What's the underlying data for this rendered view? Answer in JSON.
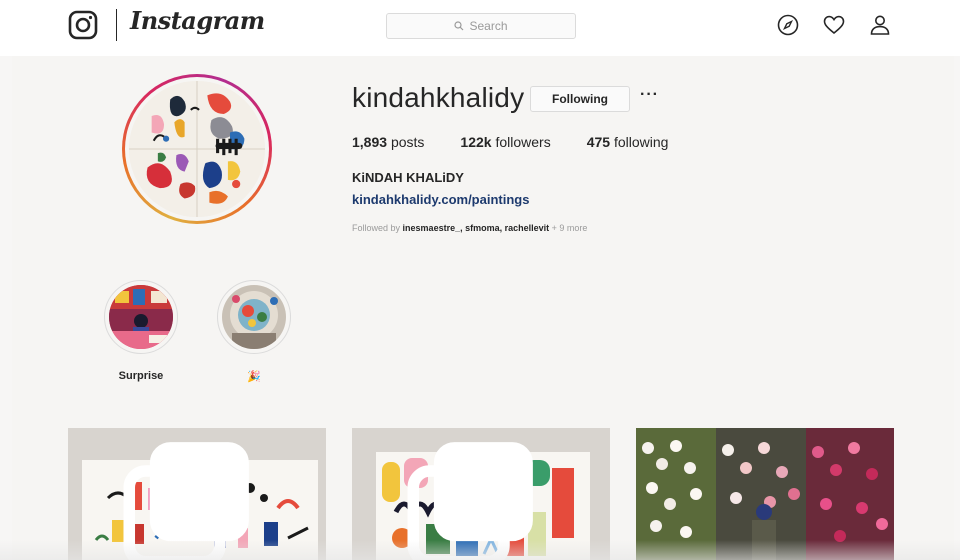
{
  "nav": {
    "wordmark": "Instagram",
    "search_placeholder": "Search",
    "icons": [
      "camera-logo-icon",
      "compass-icon",
      "heart-icon",
      "person-icon"
    ]
  },
  "profile": {
    "username": "kindahkhalidy",
    "follow_button_label": "Following",
    "more_label": "···",
    "posts_count": "1,893",
    "posts_label": "posts",
    "followers_count": "122k",
    "followers_label": "followers",
    "following_count": "475",
    "following_label": "following",
    "full_name": "KiNDAH KHALiDY",
    "website": "kindahkhalidy.com/paintings",
    "followed_by_prefix": "Followed by",
    "followed_by_users": "inesmaestre_, sfmoma, rachellevit",
    "followed_by_suffix": "+ 9 more"
  },
  "highlights": [
    {
      "label": "Surprise"
    },
    {
      "label": "🎉"
    }
  ],
  "colors": {
    "accent_link": "#1d3a6e",
    "ring_gradient": [
      "#e0b040",
      "#e8702a",
      "#d8275f",
      "#b22c8f"
    ]
  }
}
